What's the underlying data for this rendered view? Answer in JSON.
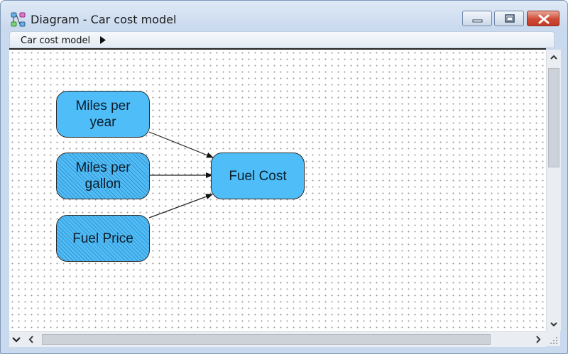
{
  "window": {
    "title": "Diagram - Car cost model",
    "icon": "diagram-icon"
  },
  "breadcrumb": {
    "label": "Car cost model",
    "arrow_icon": "play-triangle-icon"
  },
  "nodes": [
    {
      "id": "miles-per-year",
      "line1": "Miles per",
      "line2": "year",
      "hatched": false
    },
    {
      "id": "miles-per-gallon",
      "line1": "Miles per",
      "line2": "gallon",
      "hatched": true
    },
    {
      "id": "fuel-price",
      "line1": "Fuel Price",
      "line2": "",
      "hatched": true
    },
    {
      "id": "fuel-cost",
      "line1": "Fuel Cost",
      "line2": "",
      "hatched": false
    }
  ],
  "edges": [
    {
      "from": "miles-per-year",
      "to": "fuel-cost"
    },
    {
      "from": "miles-per-gallon",
      "to": "fuel-cost"
    },
    {
      "from": "fuel-price",
      "to": "fuel-cost"
    }
  ],
  "colors": {
    "node_fill": "#4fbef8",
    "node_border": "#2b2b2b",
    "close_button": "#cf4a36"
  }
}
